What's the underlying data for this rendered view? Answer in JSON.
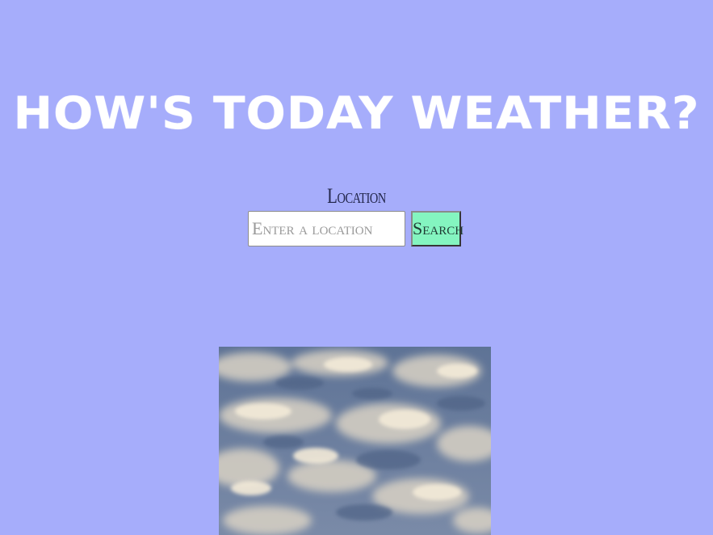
{
  "header": {
    "title": "HOW'S TODAY WEATHER?"
  },
  "search": {
    "label": "Location",
    "placeholder": "Enter a location",
    "value": "",
    "button_label": "Search"
  },
  "colors": {
    "background": "#a6adfb",
    "title": "#ffffff",
    "button": "#84f5c0",
    "label": "#22264a"
  },
  "media": {
    "image_icon": "clouds-photo"
  }
}
